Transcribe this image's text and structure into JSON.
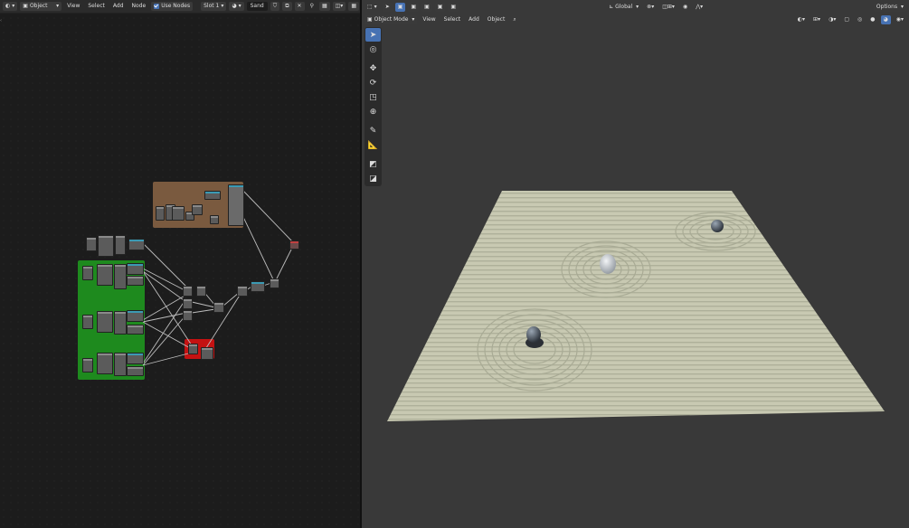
{
  "node_editor": {
    "header": {
      "editor_type_icon": "node-editor-icon",
      "mode": "Object",
      "menus": [
        "View",
        "Select",
        "Add",
        "Node"
      ],
      "use_nodes_label": "Use Nodes",
      "use_nodes_checked": true,
      "slot": "Slot 1",
      "material_name": "Sand"
    },
    "frames": [
      {
        "name": "brown-frame",
        "color": "#7a5a3f"
      },
      {
        "name": "green-frame",
        "color": "#1e8a1e"
      },
      {
        "name": "red-frame",
        "color": "#c41212"
      }
    ]
  },
  "viewport": {
    "header": {
      "editor_type_icon": "3d-viewport-icon",
      "mode": "Object Mode",
      "menus": [
        "View",
        "Select",
        "Add",
        "Object"
      ],
      "transform_orientation": "Global",
      "options_label": "Options"
    },
    "tools": [
      "select-box-icon",
      "cursor-icon",
      "move-icon",
      "rotate-icon",
      "scale-icon",
      "transform-icon",
      "annotate-icon",
      "measure-icon",
      "add-cube-icon",
      "extrude-icon"
    ],
    "active_tool": "select-box-icon",
    "colors": {
      "sand": "#c8c9b2",
      "background": "#393939",
      "accent": "#4772b3"
    }
  }
}
